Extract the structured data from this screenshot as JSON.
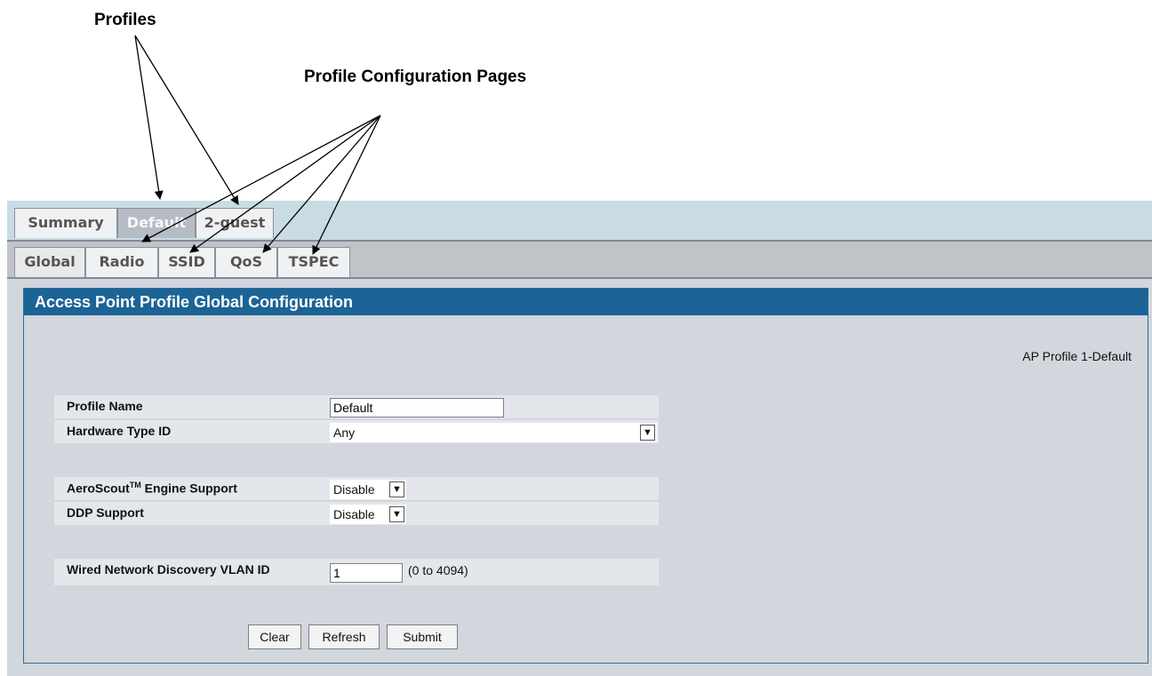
{
  "callouts": {
    "profiles": "Profiles",
    "config_pages": "Profile Configuration Pages"
  },
  "top_tabs": [
    {
      "label": "Summary",
      "active": false
    },
    {
      "label": "Default",
      "active": true
    },
    {
      "label": "2-guest",
      "active": false
    }
  ],
  "sub_tabs": [
    {
      "label": "Global",
      "active": true
    },
    {
      "label": "Radio",
      "active": false
    },
    {
      "label": "SSID",
      "active": false
    },
    {
      "label": "QoS",
      "active": false
    },
    {
      "label": "TSPEC",
      "active": false
    }
  ],
  "panel": {
    "title": "Access Point Profile Global Configuration",
    "profile_tag": "AP Profile 1-Default"
  },
  "form": {
    "profile_name": {
      "label": "Profile Name",
      "value": "Default"
    },
    "hardware_type": {
      "label": "Hardware Type ID",
      "value": "Any"
    },
    "aeroscout": {
      "label": "AeroScout",
      "label_sup": "TM",
      "label_suffix": " Engine Support",
      "value": "Disable"
    },
    "ddp": {
      "label": "DDP Support",
      "value": "Disable"
    },
    "vlan": {
      "label": "Wired Network Discovery VLAN ID",
      "value": "1",
      "hint": "(0 to 4094)"
    }
  },
  "buttons": {
    "clear": "Clear",
    "refresh": "Refresh",
    "submit": "Submit"
  },
  "icons": {
    "dropdown": "chevron-down-icon"
  }
}
